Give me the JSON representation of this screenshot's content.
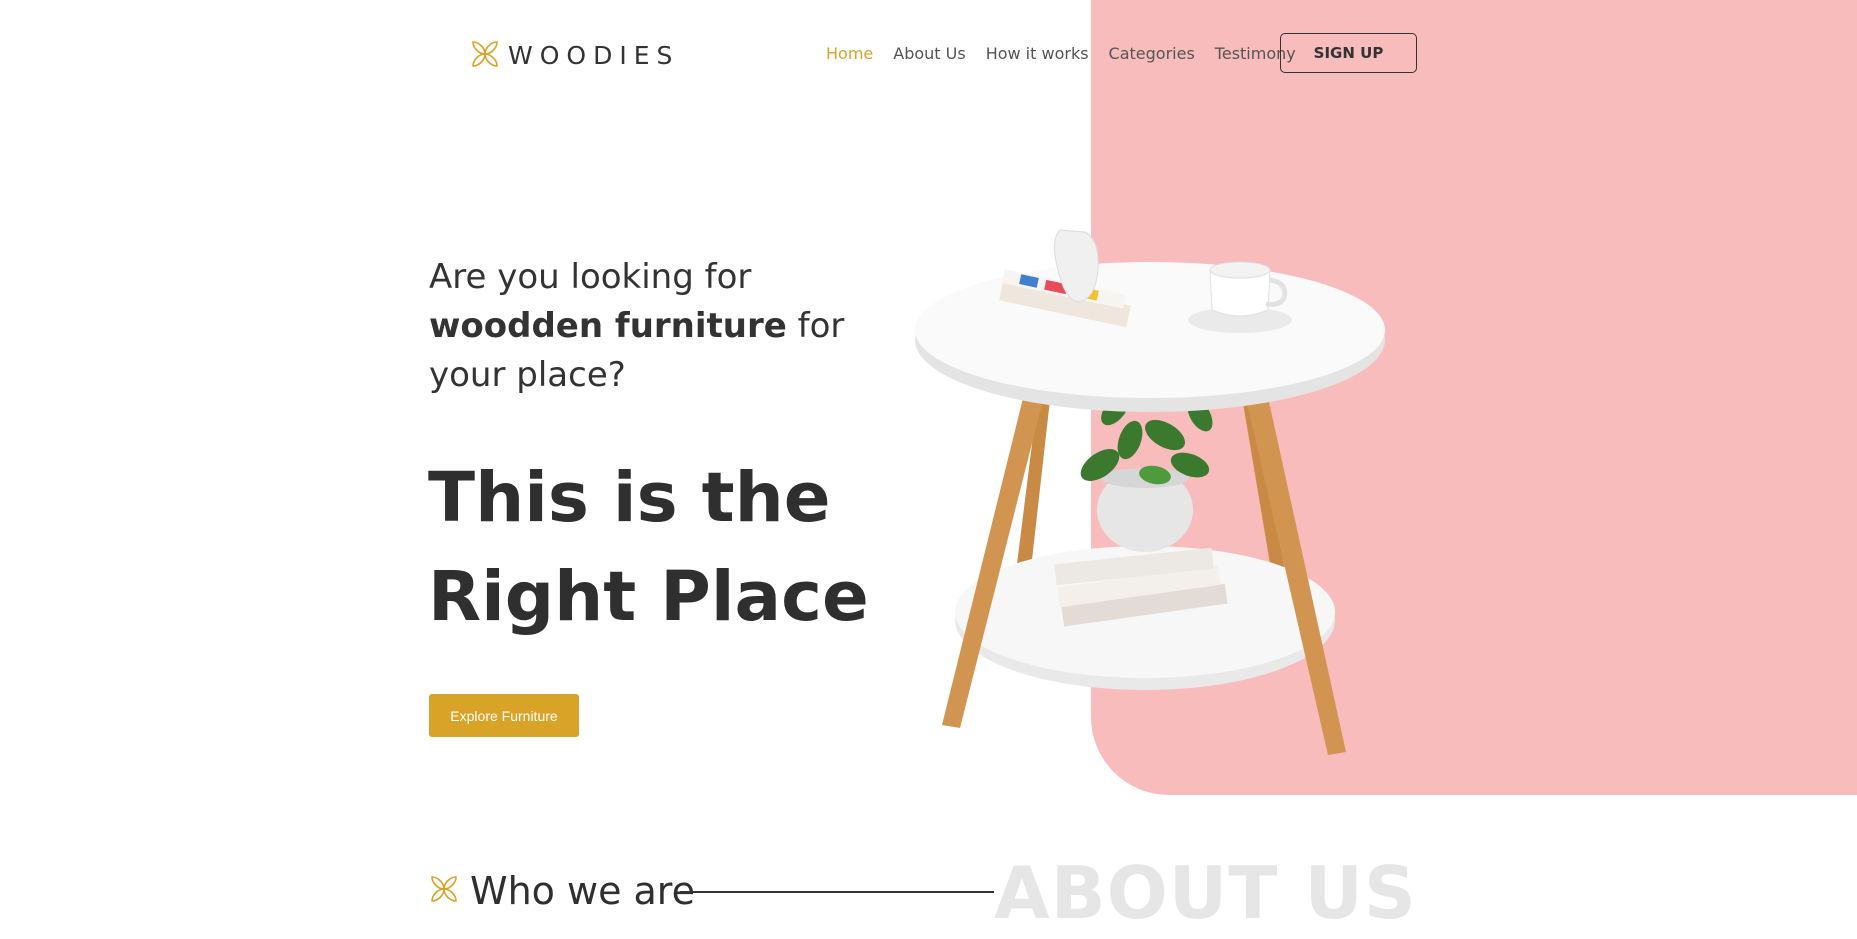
{
  "brand": {
    "name": "WOODIES",
    "icon": "flower-icon",
    "accent": "#d9a327"
  },
  "nav": {
    "items": [
      {
        "label": "Home",
        "active": true
      },
      {
        "label": "About Us",
        "active": false
      },
      {
        "label": "How it works",
        "active": false
      },
      {
        "label": "Categories",
        "active": false
      },
      {
        "label": "Testimony",
        "active": false
      }
    ],
    "signup_label": "SIGN UP"
  },
  "hero": {
    "subtitle_prefix": "Are you looking for",
    "subtitle_bold": "woodden furniture",
    "subtitle_suffix": "for your place?",
    "title_line1": "This is the",
    "title_line2": "Right Place",
    "cta_label": "Explore Furniture",
    "panel_color": "#f8bcbc"
  },
  "about": {
    "heading": "Who we are",
    "background_text": "ABOUT US",
    "icon": "flower-icon"
  }
}
